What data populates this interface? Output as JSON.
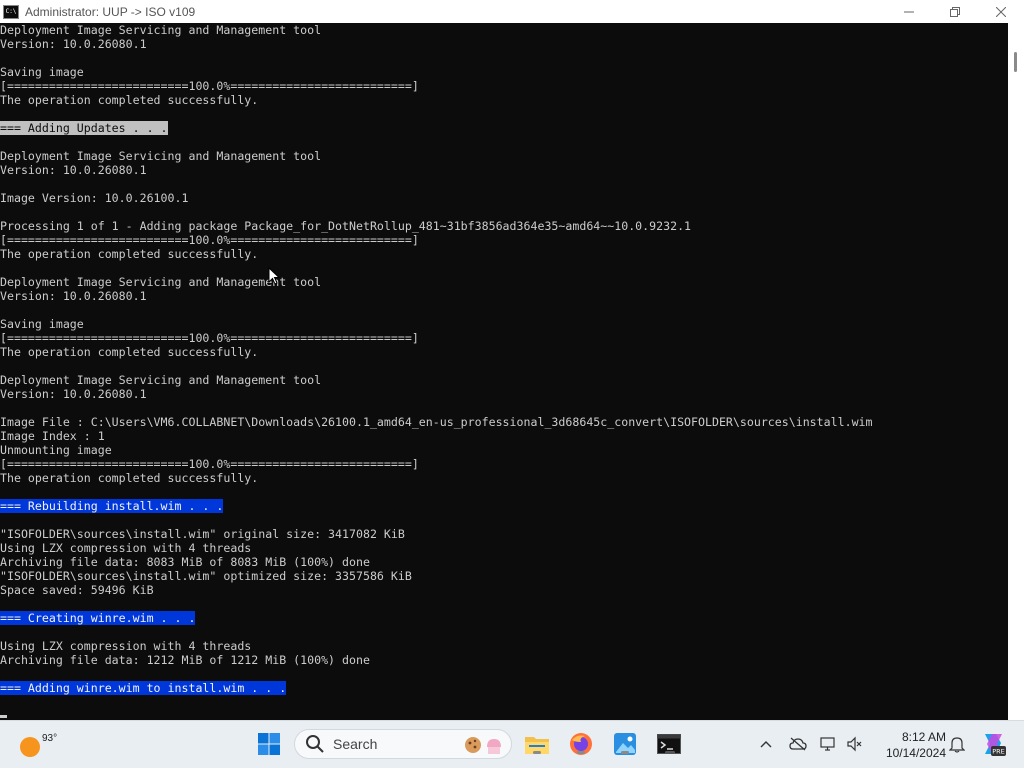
{
  "window": {
    "title": "Administrator:  UUP -> ISO v109",
    "app_icon_text": "C:\\",
    "minimize_glyph": "—",
    "maximize_glyph": "❐",
    "close_glyph": "✕"
  },
  "console": {
    "lines": [
      {
        "text": "Deployment Image Servicing and Management tool",
        "hl": ""
      },
      {
        "text": "Version: 10.0.26080.1",
        "hl": ""
      },
      {
        "text": "",
        "hl": ""
      },
      {
        "text": "Saving image",
        "hl": ""
      },
      {
        "text": "[==========================100.0%==========================]",
        "hl": ""
      },
      {
        "text": "The operation completed successfully.",
        "hl": ""
      },
      {
        "text": "",
        "hl": ""
      },
      {
        "text": "=== Adding Updates . . .",
        "hl": "gray"
      },
      {
        "text": "",
        "hl": ""
      },
      {
        "text": "Deployment Image Servicing and Management tool",
        "hl": ""
      },
      {
        "text": "Version: 10.0.26080.1",
        "hl": ""
      },
      {
        "text": "",
        "hl": ""
      },
      {
        "text": "Image Version: 10.0.26100.1",
        "hl": ""
      },
      {
        "text": "",
        "hl": ""
      },
      {
        "text": "Processing 1 of 1 - Adding package Package_for_DotNetRollup_481~31bf3856ad364e35~amd64~~10.0.9232.1",
        "hl": ""
      },
      {
        "text": "[==========================100.0%==========================]",
        "hl": ""
      },
      {
        "text": "The operation completed successfully.",
        "hl": ""
      },
      {
        "text": "",
        "hl": ""
      },
      {
        "text": "Deployment Image Servicing and Management tool",
        "hl": ""
      },
      {
        "text": "Version: 10.0.26080.1",
        "hl": ""
      },
      {
        "text": "",
        "hl": ""
      },
      {
        "text": "Saving image",
        "hl": ""
      },
      {
        "text": "[==========================100.0%==========================]",
        "hl": ""
      },
      {
        "text": "The operation completed successfully.",
        "hl": ""
      },
      {
        "text": "",
        "hl": ""
      },
      {
        "text": "Deployment Image Servicing and Management tool",
        "hl": ""
      },
      {
        "text": "Version: 10.0.26080.1",
        "hl": ""
      },
      {
        "text": "",
        "hl": ""
      },
      {
        "text": "Image File : C:\\Users\\VM6.COLLABNET\\Downloads\\26100.1_amd64_en-us_professional_3d68645c_convert\\ISOFOLDER\\sources\\install.wim",
        "hl": ""
      },
      {
        "text": "Image Index : 1",
        "hl": ""
      },
      {
        "text": "Unmounting image",
        "hl": ""
      },
      {
        "text": "[==========================100.0%==========================]",
        "hl": ""
      },
      {
        "text": "The operation completed successfully.",
        "hl": ""
      },
      {
        "text": "",
        "hl": ""
      },
      {
        "text": "=== Rebuilding install.wim . . .",
        "hl": "blue"
      },
      {
        "text": "",
        "hl": ""
      },
      {
        "text": "\"ISOFOLDER\\sources\\install.wim\" original size: 3417082 KiB",
        "hl": ""
      },
      {
        "text": "Using LZX compression with 4 threads",
        "hl": ""
      },
      {
        "text": "Archiving file data: 8083 MiB of 8083 MiB (100%) done",
        "hl": ""
      },
      {
        "text": "\"ISOFOLDER\\sources\\install.wim\" optimized size: 3357586 KiB",
        "hl": ""
      },
      {
        "text": "Space saved: 59496 KiB",
        "hl": ""
      },
      {
        "text": "",
        "hl": ""
      },
      {
        "text": "=== Creating winre.wim . . .",
        "hl": "blue"
      },
      {
        "text": "",
        "hl": ""
      },
      {
        "text": "Using LZX compression with 4 threads",
        "hl": ""
      },
      {
        "text": "Archiving file data: 1212 MiB of 1212 MiB (100%) done",
        "hl": ""
      },
      {
        "text": "",
        "hl": ""
      },
      {
        "text": "=== Adding winre.wim to install.wim . . .",
        "hl": "blue"
      },
      {
        "text": "",
        "hl": ""
      },
      {
        "text": "",
        "hl": "",
        "cursor": true
      }
    ]
  },
  "colors": {
    "console_bg": "#0c0c0c",
    "console_fg": "#cccccc",
    "highlight_gray": "#c0c0c0",
    "highlight_blue": "#0037da"
  },
  "taskbar": {
    "weather": {
      "temp": "93°",
      "icon": "sun-icon"
    },
    "search_label": "Search",
    "pinned": [
      {
        "name": "file-explorer-icon",
        "running": true
      },
      {
        "name": "firefox-icon",
        "running": true
      },
      {
        "name": "photos-icon",
        "running": true
      },
      {
        "name": "terminal-icon",
        "running": true
      }
    ],
    "tray": {
      "chevron": "^",
      "icons": [
        "onedrive-icon",
        "network-icon",
        "volume-icon"
      ]
    },
    "clock": {
      "time": "8:12 AM",
      "date": "10/14/2024"
    },
    "copilot_badge": "PRE"
  }
}
